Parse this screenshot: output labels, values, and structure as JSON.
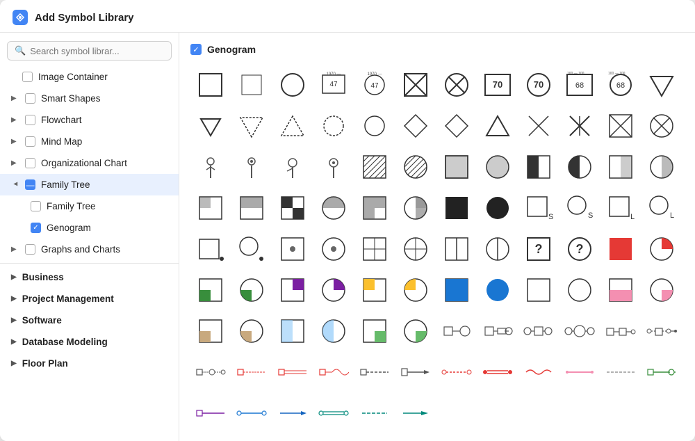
{
  "window": {
    "title": "Add Symbol Library"
  },
  "search": {
    "placeholder": "Search symbol librar..."
  },
  "sidebar": {
    "items": [
      {
        "id": "image-container",
        "label": "Image Container",
        "type": "checkbox",
        "checked": false,
        "indent": 1
      },
      {
        "id": "smart-shapes",
        "label": "Smart Shapes",
        "type": "checkbox-expand",
        "checked": false,
        "indent": 0
      },
      {
        "id": "flowchart",
        "label": "Flowchart",
        "type": "checkbox-expand",
        "checked": false,
        "indent": 0
      },
      {
        "id": "mind-map",
        "label": "Mind Map",
        "type": "checkbox-expand",
        "checked": false,
        "indent": 0
      },
      {
        "id": "org-chart",
        "label": "Organizational Chart",
        "type": "checkbox-expand",
        "checked": false,
        "indent": 0
      },
      {
        "id": "family-tree",
        "label": "Family Tree",
        "type": "checkbox-expand-open",
        "checked": "minus",
        "indent": 0
      },
      {
        "id": "family-tree-sub",
        "label": "Family Tree",
        "type": "checkbox",
        "checked": false,
        "indent": 2
      },
      {
        "id": "genogram",
        "label": "Genogram",
        "type": "checkbox",
        "checked": true,
        "indent": 2
      },
      {
        "id": "graphs-charts",
        "label": "Graphs and Charts",
        "type": "checkbox-expand",
        "checked": false,
        "indent": 0
      }
    ],
    "sections": [
      {
        "id": "business",
        "label": "Business"
      },
      {
        "id": "project-management",
        "label": "Project Management"
      },
      {
        "id": "software",
        "label": "Software"
      },
      {
        "id": "database-modeling",
        "label": "Database Modeling"
      },
      {
        "id": "floor-plan",
        "label": "Floor Plan"
      }
    ]
  },
  "panel": {
    "title": "Genogram",
    "checkbox_checked": true
  }
}
